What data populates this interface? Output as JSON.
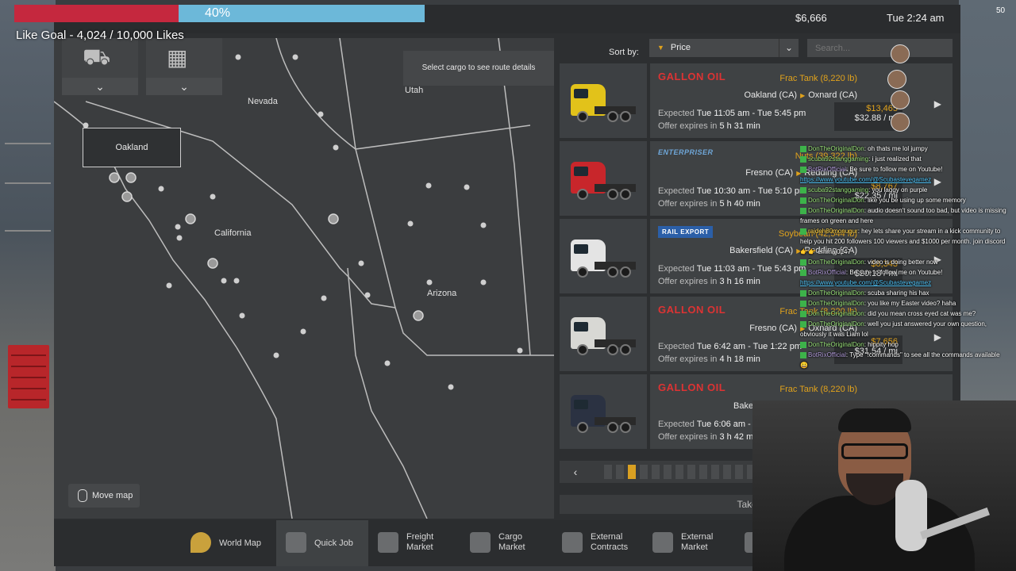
{
  "stream": {
    "goal_percent": "40%",
    "goal_fill": 0.4,
    "goal_text": "Like Goal - 4,024 / 10,000 Likes",
    "viewers": "50"
  },
  "status": {
    "money": "$6,666",
    "time": "Tue 2:24 am"
  },
  "map": {
    "hint": "Select cargo to see route details",
    "tooltip": "Oakland",
    "states": [
      "Nevada",
      "Utah",
      "California",
      "Arizona"
    ],
    "move_map": "Move map"
  },
  "sort": {
    "label": "Sort by:",
    "value": "Price",
    "search_placeholder": "Search..."
  },
  "jobs": [
    {
      "company": "GALLON OIL",
      "cargo": "Frac Tank (8,220 lb)",
      "from": "Oakland (CA)",
      "to": "Oxnard (CA)",
      "expected_label": "Expected",
      "expected": "Tue 11:05 am - Tue 5:45 pm",
      "offer_label": "Offer expires in",
      "offer": "5 h 31 min",
      "pay": "$13,465",
      "rate": "$32.88 / mi",
      "truck_color": "#e2c21a"
    },
    {
      "company": "ENTERPRISER",
      "cargo": "Nuts (39,322 lb)",
      "from": "Fresno (CA)",
      "to": "Redding (CA)",
      "expected_label": "Expected",
      "expected": "Tue 10:30 am - Tue 5:10 pm",
      "offer_label": "Offer expires in",
      "offer": "5 h 40 min",
      "pay": "$8,767",
      "rate": "$22.35 / mi",
      "truck_color": "#c8262b"
    },
    {
      "company": "RAIL EXPORT",
      "cargo": "Soybean (42,544 lb)",
      "from": "Bakersfield (CA)",
      "to": "Redding (CA)",
      "expected_label": "Expected",
      "expected": "Tue 11:03 am - Tue 5:43 pm",
      "offer_label": "Offer expires in",
      "offer": "3 h 16 min",
      "pay": "$8,343",
      "rate": "$20.13 / mi",
      "truck_color": "#e4e4e4"
    },
    {
      "company": "GALLON OIL",
      "cargo": "Frac Tank (8,220 lb)",
      "from": "Fresno (CA)",
      "to": "Oxnard (CA)",
      "expected_label": "Expected",
      "expected": "Tue 6:42 am - Tue 1:22 pm",
      "offer_label": "Offer expires in",
      "offer": "4 h 18 min",
      "pay": "$7,656",
      "rate": "$31.54 / mi",
      "truck_color": "#d8d8d4"
    },
    {
      "company": "GALLON OIL",
      "cargo": "Frac Tank (8,220 lb)",
      "from": "Bakersfield (CA)",
      "to": "Oxnard (CA)",
      "expected_label": "Expected",
      "expected": "Tue 6:06 am - Tue 12:46 pm",
      "offer_label": "Offer expires in",
      "offer": "3 h 42 min",
      "pay": "$",
      "rate": "",
      "truck_color": "#2b3242"
    }
  ],
  "pager": {
    "prev": "‹",
    "next": "›",
    "count": 20,
    "active": 2
  },
  "take_job": "Take Job",
  "nav": [
    {
      "label": "World Map",
      "icon": "world-map-icon"
    },
    {
      "label": "Quick Job",
      "icon": "quick-job-icon"
    },
    {
      "label": "Freight\nMarket",
      "icon": "freight-market-icon"
    },
    {
      "label": "Cargo\nMarket",
      "icon": "cargo-market-icon"
    },
    {
      "label": "External\nContracts",
      "icon": "external-contracts-icon"
    },
    {
      "label": "External\nMarket",
      "icon": "external-market-icon"
    }
  ],
  "chat": [
    {
      "user": "DonTheOriginalDon",
      "text": "oh thats me lol jumpy"
    },
    {
      "user": "scuba92stanggaming",
      "text": "i just realized that"
    },
    {
      "user": "BotRixOfficial",
      "text": "Be sure to follow me on Youtube!"
    },
    {
      "link": "https://www.youtube.com/@Scubastevegamez"
    },
    {
      "user": "scuba92stanggaming",
      "text": "you laggy on purple"
    },
    {
      "user": "DonTheOriginalDon",
      "text": "like you be using up some memory"
    },
    {
      "user": "DonTheOriginalDon",
      "text": "audio doesn't sound too bad, but video is missing frames on green and here"
    },
    {
      "user": "rajdeh80monugur",
      "text": "hey lets share your stream in a kick community to help you hit 200 followers 100 viewers and $1000 per month. join discord 👉👉 emmaj0147"
    },
    {
      "user": "DonTheOriginalDon",
      "text": "video is doing better now"
    },
    {
      "user": "BotRixOfficial",
      "text": "Be sure to follow me on Youtube!"
    },
    {
      "link": "https://www.youtube.com/@Scubastevegamez"
    },
    {
      "user": "DonTheOriginalDon",
      "text": "scuba sharing his hax"
    },
    {
      "user": "DonTheOriginalDon",
      "text": "you like my Easter video? haha"
    },
    {
      "user": "DonTheOriginalDon",
      "text": "did you mean cross eyed cat was me?"
    },
    {
      "user": "DonTheOriginalDon",
      "text": "well you just answered your own question, obviously it was Liam lol"
    },
    {
      "user": "DonTheOriginalDon",
      "text": "hippity hop"
    },
    {
      "user": "BotRixOfficial",
      "text": "Type \"!commands\" to see all the commands available 😀"
    }
  ]
}
